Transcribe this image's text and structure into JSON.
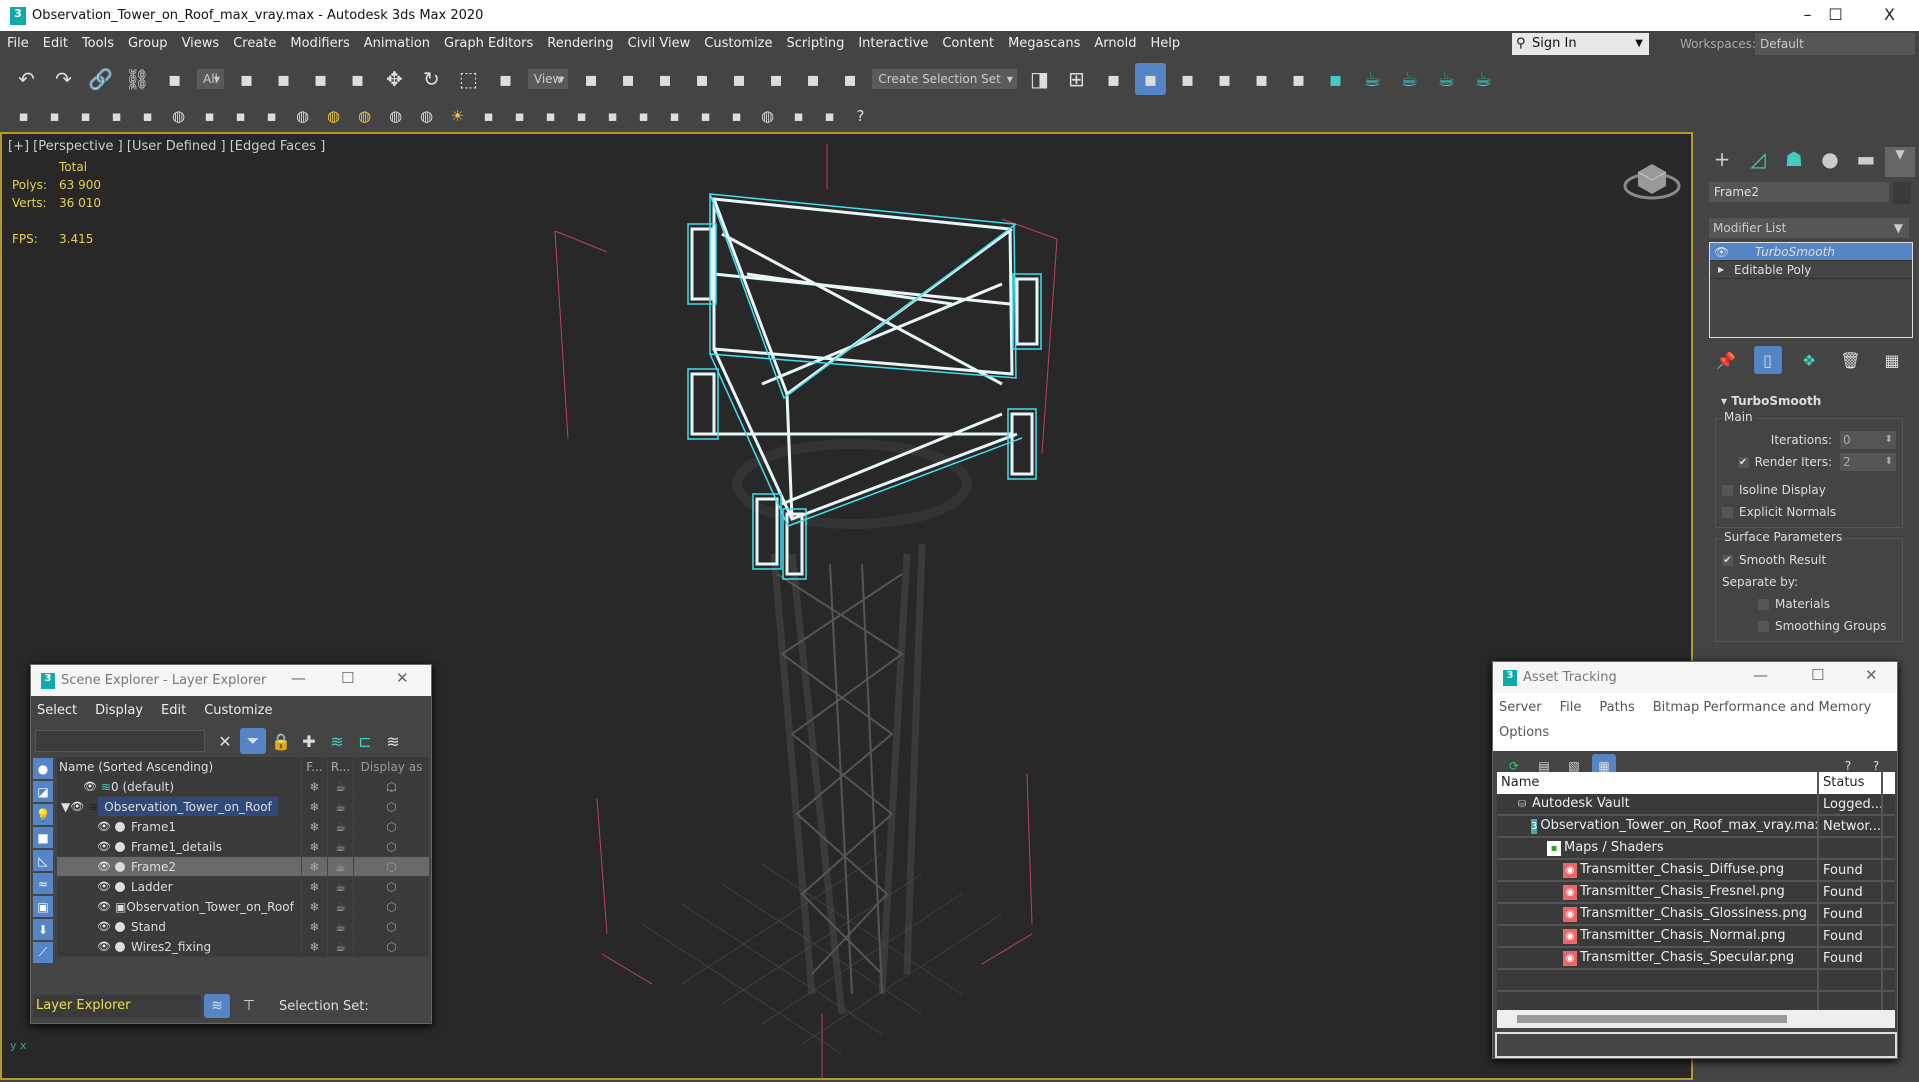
{
  "window": {
    "title": "Observation_Tower_on_Roof_max_vray.max - Autodesk 3ds Max 2020",
    "minimize": "–",
    "maximize": "☐",
    "close": "X"
  },
  "menu": [
    "File",
    "Edit",
    "Tools",
    "Group",
    "Views",
    "Create",
    "Modifiers",
    "Animation",
    "Graph Editors",
    "Rendering",
    "Civil View",
    "Customize",
    "Scripting",
    "Interactive",
    "Content",
    "Megascans",
    "Arnold",
    "Help"
  ],
  "account": {
    "sign_in": "Sign In",
    "workspaces_label": "Workspaces:",
    "workspace": "Default"
  },
  "toolbar": {
    "filter": "All",
    "ref_coord": "View",
    "selection_set": "Create Selection Set",
    "icons1": [
      "undo-icon",
      "redo-icon",
      "link-icon",
      "unlink-icon",
      "bind-space-warp-icon",
      "|filter",
      "select-object-icon",
      "select-by-name-icon",
      "rect-selection-icon",
      "window-crossing-icon",
      "move-icon",
      "rotate-icon",
      "scale-icon",
      "select-place-icon",
      "|ref",
      "pivot-icon",
      "select-manipulate-icon",
      "keyboard-shortcut-icon",
      "snap-3d-icon",
      "angle-snap-icon",
      "percent-snap-icon",
      "spinner-snap-icon",
      "edit-named-selection-icon",
      "|selset",
      "mirror-icon",
      "align-icon",
      "scene-explorer-icon",
      "layer-explorer-icon",
      "ribbon-icon",
      "curve-editor-icon",
      "dope-sheet-icon",
      "schematic-view-icon",
      "material-editor-icon",
      "render-setup-icon",
      "rendered-frame-icon",
      "render-icon",
      "render-iterative-icon"
    ],
    "icons2": [
      "sphere-tool-icon",
      "cloud-tool-icon",
      "doc-icon",
      "doc2-icon",
      "doc3-icon",
      "light-icon",
      "camera-icon",
      "vray-icon",
      "vray2-icon",
      "plane-light-icon",
      "dome-light-icon",
      "sphere-light-icon",
      "mesh-light-icon",
      "cone-light-icon",
      "sun-icon",
      "ies-icon",
      "fur-icon",
      "proxy-icon",
      "displace-icon",
      "vray-obj-icon",
      "plant-icon",
      "hair-icon",
      "clipper-icon",
      "vray-material-icon",
      "lightmix-icon",
      "vfb-icon",
      "converter-icon",
      "help-icon"
    ]
  },
  "viewport": {
    "label": "[+] [Perspective ] [User Defined ] [Edged Faces ]",
    "stats": {
      "header": "Total",
      "polys_label": "Polys:",
      "polys": "63 900",
      "verts_label": "Verts:",
      "verts": "36 010",
      "fps_label": "FPS:",
      "fps": "3.415"
    }
  },
  "command_panel": {
    "object_name": "Frame2",
    "modifier_list": "Modifier List",
    "stack": [
      "TurboSmooth",
      "Editable Poly"
    ],
    "rollout": {
      "title": "TurboSmooth",
      "main_label": "Main",
      "iterations_label": "Iterations:",
      "iterations": "0",
      "render_iters_label": "Render Iters:",
      "render_iters": "2",
      "render_iters_checked": true,
      "isoline": "Isoline Display",
      "explicit_normals": "Explicit Normals",
      "surface_label": "Surface Parameters",
      "smooth_result": "Smooth Result",
      "separate_by": "Separate by:",
      "materials": "Materials",
      "smoothing_groups": "Smoothing Groups"
    }
  },
  "scene_explorer": {
    "title": "Scene Explorer - Layer Explorer",
    "menu": [
      "Select",
      "Display",
      "Edit",
      "Customize"
    ],
    "columns": {
      "name": "Name (Sorted Ascending)",
      "frozen": "F...",
      "render": "R...",
      "display": "Display as ..."
    },
    "rows": [
      {
        "name": "0 (default)",
        "level": 0,
        "type": "layer"
      },
      {
        "name": "Observation_Tower_on_Roof",
        "level": 0,
        "type": "layer",
        "selected": true
      },
      {
        "name": "Frame1",
        "level": 1,
        "type": "object"
      },
      {
        "name": "Frame1_details",
        "level": 1,
        "type": "object"
      },
      {
        "name": "Frame2",
        "level": 1,
        "type": "object",
        "highlight": true
      },
      {
        "name": "Ladder",
        "level": 1,
        "type": "object"
      },
      {
        "name": "Observation_Tower_on_Roof",
        "level": 1,
        "type": "group"
      },
      {
        "name": "Stand",
        "level": 1,
        "type": "object"
      },
      {
        "name": "Wires2_fixing",
        "level": 1,
        "type": "object"
      }
    ],
    "footer": {
      "explorer": "Layer Explorer",
      "selection_set": "Selection Set:"
    }
  },
  "asset_tracking": {
    "title": "Asset Tracking",
    "menu": [
      "Server",
      "File",
      "Paths",
      "Bitmap Performance and Memory",
      "Options"
    ],
    "columns": {
      "name": "Name",
      "status": "Status"
    },
    "rows": [
      {
        "name": "Autodesk Vault",
        "status": "Logged...",
        "level": 0
      },
      {
        "name": "Observation_Tower_on_Roof_max_vray.max",
        "status": "Networ...",
        "level": 1
      },
      {
        "name": "Maps / Shaders",
        "status": "",
        "level": 2
      },
      {
        "name": "Transmitter_Chasis_Diffuse.png",
        "status": "Found",
        "level": 3
      },
      {
        "name": "Transmitter_Chasis_Fresnel.png",
        "status": "Found",
        "level": 3
      },
      {
        "name": "Transmitter_Chasis_Glossiness.png",
        "status": "Found",
        "level": 3
      },
      {
        "name": "Transmitter_Chasis_Normal.png",
        "status": "Found",
        "level": 3
      },
      {
        "name": "Transmitter_Chasis_Specular.png",
        "status": "Found",
        "level": 3
      }
    ]
  },
  "colors": {
    "accent": "#5585c5",
    "selection_cyan": "#41e0f0",
    "stats_yellow": "#e6d150",
    "viewport_border": "#b59a2a"
  }
}
